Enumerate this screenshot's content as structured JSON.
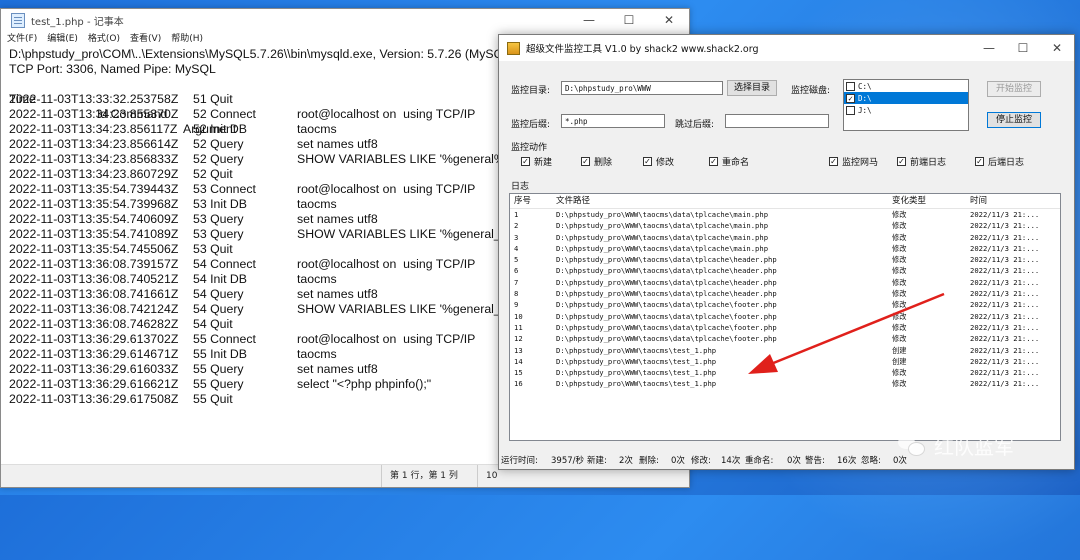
{
  "notepad": {
    "title": "test_1.php - 记事本",
    "menu": [
      "文件(F)",
      "编辑(E)",
      "格式(O)",
      "查看(V)",
      "帮助(H)"
    ],
    "header_lines": [
      "D:\\phpstudy_pro\\COM\\..\\Extensions\\MySQL5.7.26\\\\bin\\mysqld.exe, Version: 5.7.26 (MySQL",
      "TCP Port: 3306, Named Pipe: MySQL"
    ],
    "col_headers": {
      "time": "Time",
      "id_command": "Id Command",
      "argument": "Argument"
    },
    "rows": [
      {
        "time": "2022-11-03T13:33:32.253758Z",
        "cmd": "51 Quit",
        "arg": ""
      },
      {
        "time": "2022-11-03T13:34:23.855370Z",
        "cmd": "52 Connect",
        "arg": "root@localhost on  using TCP/IP"
      },
      {
        "time": "2022-11-03T13:34:23.856117Z",
        "cmd": "52 Init DB",
        "arg": "taocms"
      },
      {
        "time": "2022-11-03T13:34:23.856614Z",
        "cmd": "52 Query",
        "arg": "set names utf8"
      },
      {
        "time": "2022-11-03T13:34:23.856833Z",
        "cmd": "52 Query",
        "arg": "SHOW VARIABLES LIKE '%general%'"
      },
      {
        "time": "2022-11-03T13:34:23.860729Z",
        "cmd": "52 Quit",
        "arg": ""
      },
      {
        "time": "2022-11-03T13:35:54.739443Z",
        "cmd": "53 Connect",
        "arg": "root@localhost on  using TCP/IP"
      },
      {
        "time": "2022-11-03T13:35:54.739968Z",
        "cmd": "53 Init DB",
        "arg": "taocms"
      },
      {
        "time": "2022-11-03T13:35:54.740609Z",
        "cmd": "53 Query",
        "arg": "set names utf8"
      },
      {
        "time": "2022-11-03T13:35:54.741089Z",
        "cmd": "53 Query",
        "arg": "SHOW VARIABLES LIKE '%general_log"
      },
      {
        "time": "2022-11-03T13:35:54.745506Z",
        "cmd": "53 Quit",
        "arg": ""
      },
      {
        "time": "2022-11-03T13:36:08.739157Z",
        "cmd": "54 Connect",
        "arg": "root@localhost on  using TCP/IP"
      },
      {
        "time": "2022-11-03T13:36:08.740521Z",
        "cmd": "54 Init DB",
        "arg": "taocms"
      },
      {
        "time": "2022-11-03T13:36:08.741661Z",
        "cmd": "54 Query",
        "arg": "set names utf8"
      },
      {
        "time": "2022-11-03T13:36:08.742124Z",
        "cmd": "54 Query",
        "arg": "SHOW VARIABLES LIKE '%general_log"
      },
      {
        "time": "2022-11-03T13:36:08.746282Z",
        "cmd": "54 Quit",
        "arg": ""
      },
      {
        "time": "2022-11-03T13:36:29.613702Z",
        "cmd": "55 Connect",
        "arg": "root@localhost on  using TCP/IP"
      },
      {
        "time": "2022-11-03T13:36:29.614671Z",
        "cmd": "55 Init DB",
        "arg": "taocms"
      },
      {
        "time": "2022-11-03T13:36:29.616033Z",
        "cmd": "55 Query",
        "arg": "set names utf8"
      },
      {
        "time": "2022-11-03T13:36:29.616621Z",
        "cmd": "55 Query",
        "arg": "select \"<?php phpinfo();\""
      },
      {
        "time": "2022-11-03T13:36:29.617508Z",
        "cmd": "55 Quit",
        "arg": ""
      }
    ],
    "status_pos": "第 1 行，第 1 列",
    "status_zoom": "10"
  },
  "monitor": {
    "title": "超级文件监控工具 V1.0 by shack2 www.shack2.org",
    "dir_label": "监控目录:",
    "dir_value": "D:\\phpstudy_pro\\WWW",
    "choose_dir_button": "选择目录",
    "disk_label": "监控磁盘:",
    "disks": [
      {
        "name": "C:\\",
        "checked": false,
        "selected": false
      },
      {
        "name": "D:\\",
        "checked": true,
        "selected": true
      },
      {
        "name": "J:\\",
        "checked": false,
        "selected": false
      }
    ],
    "start_button": "开始监控",
    "stop_button": "停止监控",
    "suffix_label": "监控后缀:",
    "suffix_value": "*.php",
    "skip_label": "跳过后缀:",
    "skip_value": "",
    "actions_label": "监控动作",
    "actions": [
      {
        "label": "新建",
        "checked": true
      },
      {
        "label": "删除",
        "checked": true
      },
      {
        "label": "修改",
        "checked": true
      },
      {
        "label": "重命名",
        "checked": true
      },
      {
        "label": "监控网马",
        "checked": true
      },
      {
        "label": "前端日志",
        "checked": true
      },
      {
        "label": "后端日志",
        "checked": true
      }
    ],
    "log_label": "日志",
    "log_headers": {
      "no": "序号",
      "path": "文件路径",
      "type": "变化类型",
      "time": "时间"
    },
    "log_rows": [
      {
        "no": "1",
        "path": "D:\\phpstudy_pro\\WWW\\taocms\\data\\tplcache\\main.php",
        "type": "修改",
        "time": "2022/11/3 21:..."
      },
      {
        "no": "2",
        "path": "D:\\phpstudy_pro\\WWW\\taocms\\data\\tplcache\\main.php",
        "type": "修改",
        "time": "2022/11/3 21:..."
      },
      {
        "no": "3",
        "path": "D:\\phpstudy_pro\\WWW\\taocms\\data\\tplcache\\main.php",
        "type": "修改",
        "time": "2022/11/3 21:..."
      },
      {
        "no": "4",
        "path": "D:\\phpstudy_pro\\WWW\\taocms\\data\\tplcache\\main.php",
        "type": "修改",
        "time": "2022/11/3 21:..."
      },
      {
        "no": "5",
        "path": "D:\\phpstudy_pro\\WWW\\taocms\\data\\tplcache\\header.php",
        "type": "修改",
        "time": "2022/11/3 21:..."
      },
      {
        "no": "6",
        "path": "D:\\phpstudy_pro\\WWW\\taocms\\data\\tplcache\\header.php",
        "type": "修改",
        "time": "2022/11/3 21:..."
      },
      {
        "no": "7",
        "path": "D:\\phpstudy_pro\\WWW\\taocms\\data\\tplcache\\header.php",
        "type": "修改",
        "time": "2022/11/3 21:..."
      },
      {
        "no": "8",
        "path": "D:\\phpstudy_pro\\WWW\\taocms\\data\\tplcache\\header.php",
        "type": "修改",
        "time": "2022/11/3 21:..."
      },
      {
        "no": "9",
        "path": "D:\\phpstudy_pro\\WWW\\taocms\\data\\tplcache\\footer.php",
        "type": "修改",
        "time": "2022/11/3 21:..."
      },
      {
        "no": "10",
        "path": "D:\\phpstudy_pro\\WWW\\taocms\\data\\tplcache\\footer.php",
        "type": "修改",
        "time": "2022/11/3 21:..."
      },
      {
        "no": "11",
        "path": "D:\\phpstudy_pro\\WWW\\taocms\\data\\tplcache\\footer.php",
        "type": "修改",
        "time": "2022/11/3 21:..."
      },
      {
        "no": "12",
        "path": "D:\\phpstudy_pro\\WWW\\taocms\\data\\tplcache\\footer.php",
        "type": "修改",
        "time": "2022/11/3 21:..."
      },
      {
        "no": "13",
        "path": "D:\\phpstudy_pro\\WWW\\taocms\\test_1.php",
        "type": "创建",
        "time": "2022/11/3 21:..."
      },
      {
        "no": "14",
        "path": "D:\\phpstudy_pro\\WWW\\taocms\\test_1.php",
        "type": "创建",
        "time": "2022/11/3 21:..."
      },
      {
        "no": "15",
        "path": "D:\\phpstudy_pro\\WWW\\taocms\\test_1.php",
        "type": "修改",
        "time": "2022/11/3 21:..."
      },
      {
        "no": "16",
        "path": "D:\\phpstudy_pro\\WWW\\taocms\\test_1.php",
        "type": "修改",
        "time": "2022/11/3 21:..."
      }
    ],
    "status": {
      "runtime_label": "运行时间:",
      "runtime": "3957/秒",
      "new_label": "新建:",
      "new": "2次",
      "del_label": "删除:",
      "del": "0次",
      "mod_label": "修改:",
      "mod": "14次",
      "ren_label": "重命名:",
      "ren": "0次",
      "warn_label": "警告:",
      "warn": "16次",
      "ignore_label": "忽略:",
      "ignore": "0次"
    }
  },
  "watermark": {
    "text": "红队蓝军"
  },
  "colors": {
    "desktop": "#2d8cf0",
    "selection": "#0078d7",
    "arrow": "#e0201b"
  }
}
